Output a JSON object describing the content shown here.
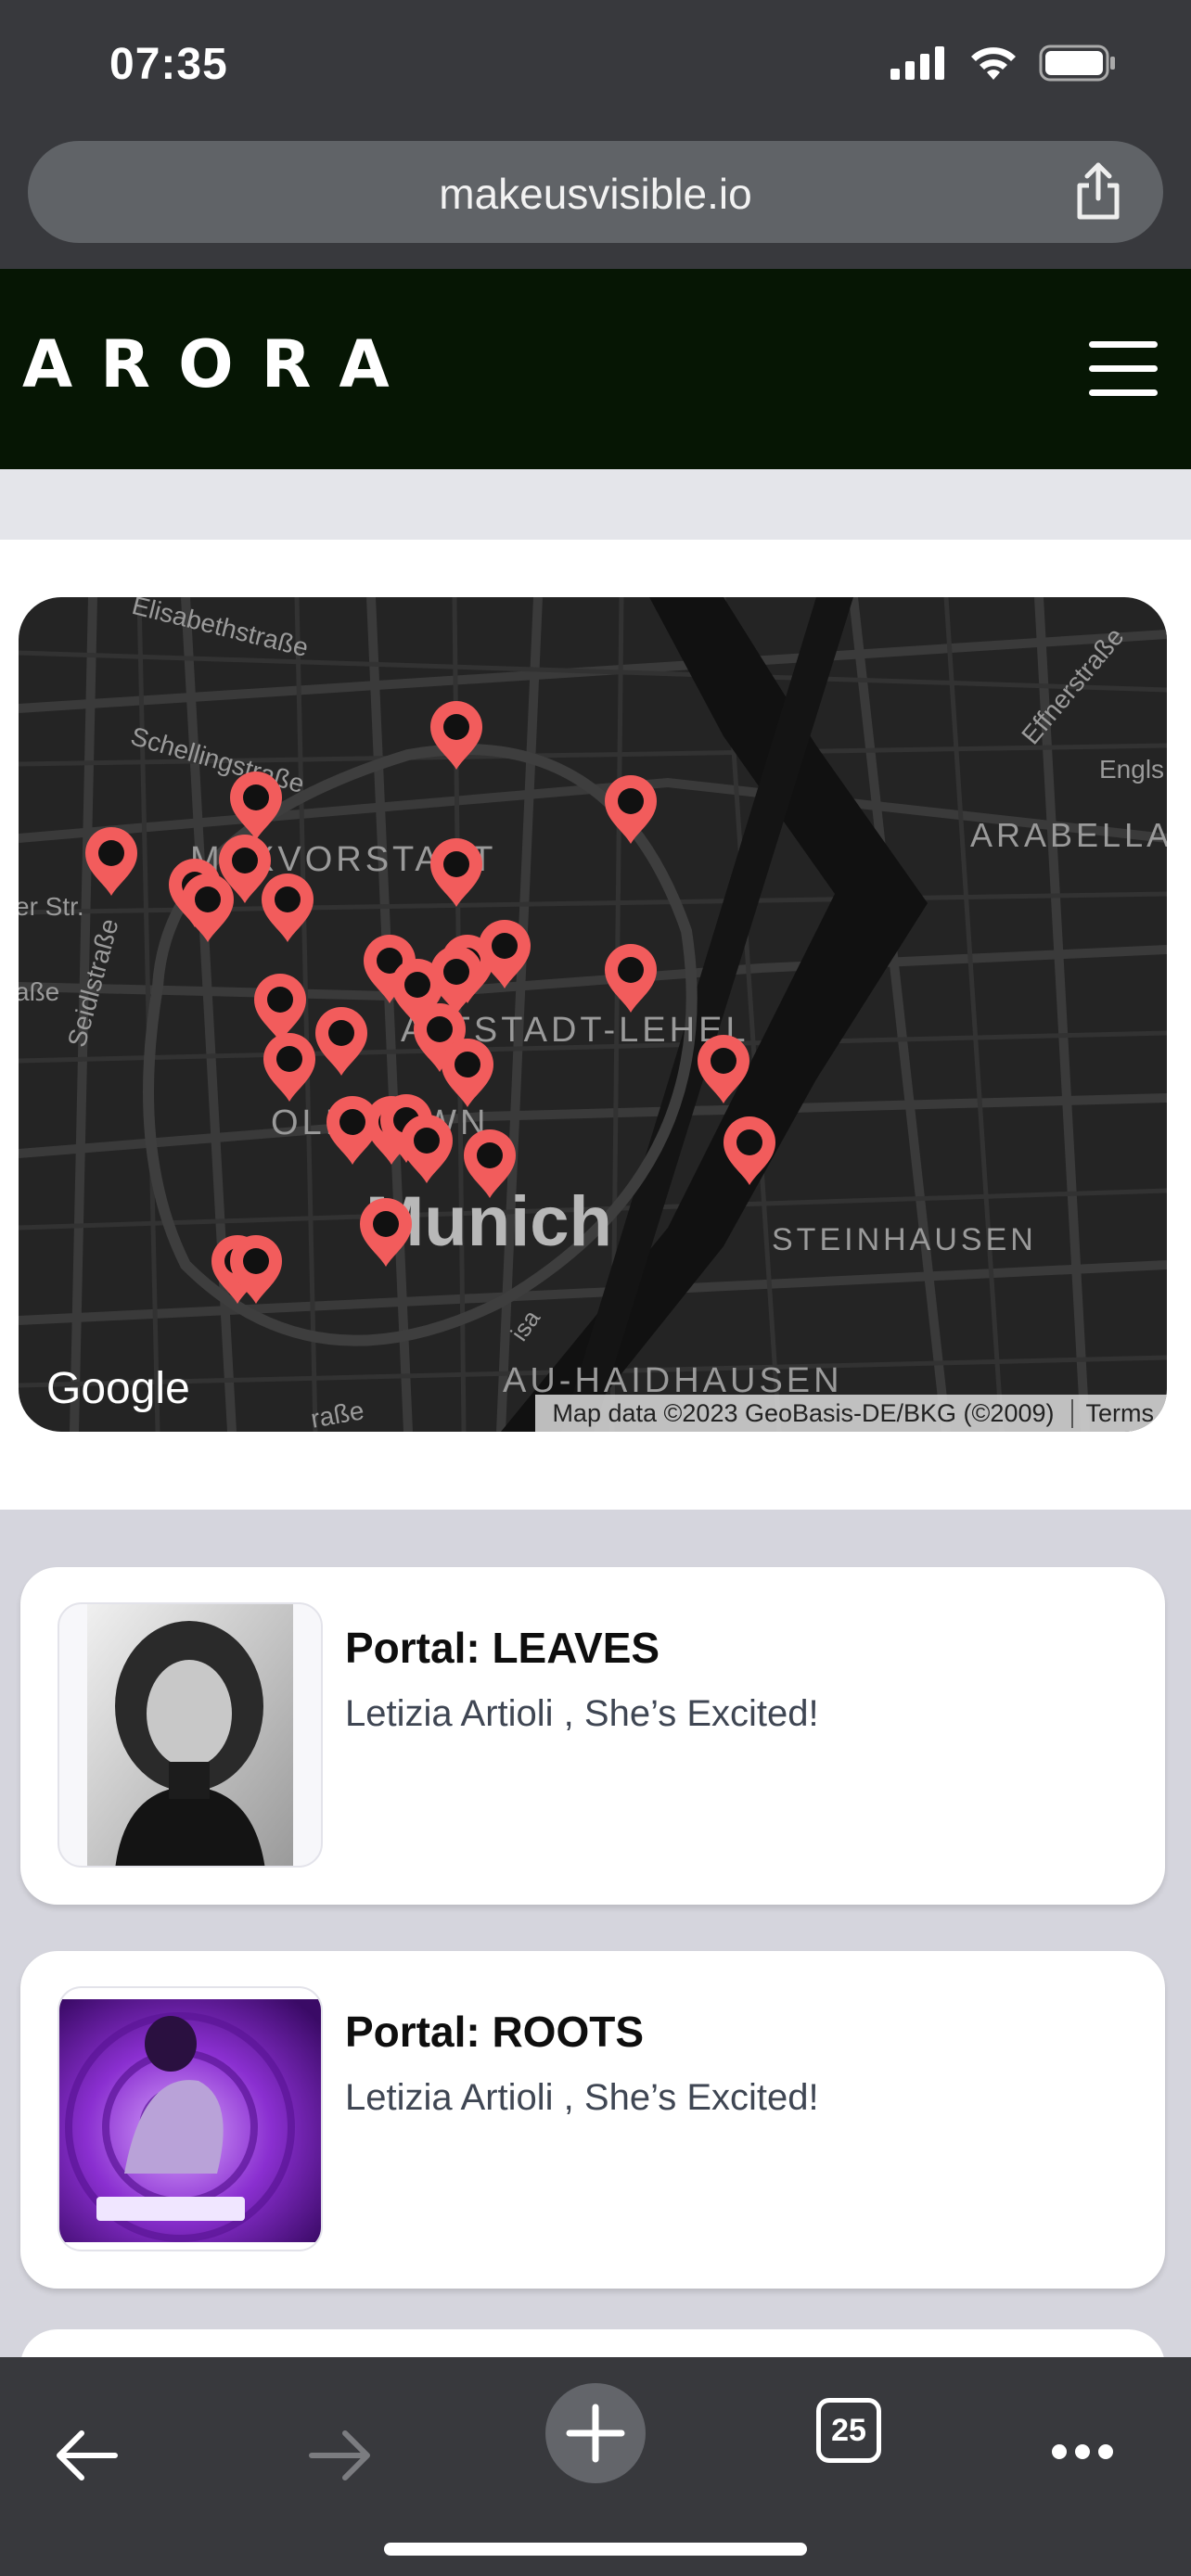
{
  "status": {
    "time": "07:35"
  },
  "browser": {
    "url": "makeusvisible.io",
    "tab_count": "25"
  },
  "site": {
    "logo": "ARORA"
  },
  "map": {
    "city_label": "Munich",
    "district_labels": [
      "MAXVORSTADT",
      "ALTSTADT-LEHEL",
      "OLD TOWN",
      "STEINHAUSEN",
      "AU-HAIDHAUSEN",
      "ARABELLA"
    ],
    "street_labels": [
      "Elisabethstraße",
      "Schellingstraße",
      "Effnerstraße",
      "Seidlstraße",
      "er Str.",
      "Engls",
      "aße",
      "raße",
      "isa"
    ],
    "google_logo": "Google",
    "attribution": "Map data ©2023 GeoBasis-DE/BKG (©2009)",
    "terms": "Terms",
    "marker_color": "#f25c5c",
    "marker_count": 30
  },
  "cards": [
    {
      "title": "Portal: LEAVES",
      "subtitle": "Letizia Artioli , She’s Excited!",
      "image": "portrait-bw"
    },
    {
      "title": "Portal: ROOTS",
      "subtitle": "Letizia Artioli , She’s Excited!",
      "image": "purple-light-performance"
    }
  ],
  "colors": {
    "header_bg": "#061604",
    "chrome_bg": "#38393d",
    "page_bg": "#d5d5dd"
  }
}
